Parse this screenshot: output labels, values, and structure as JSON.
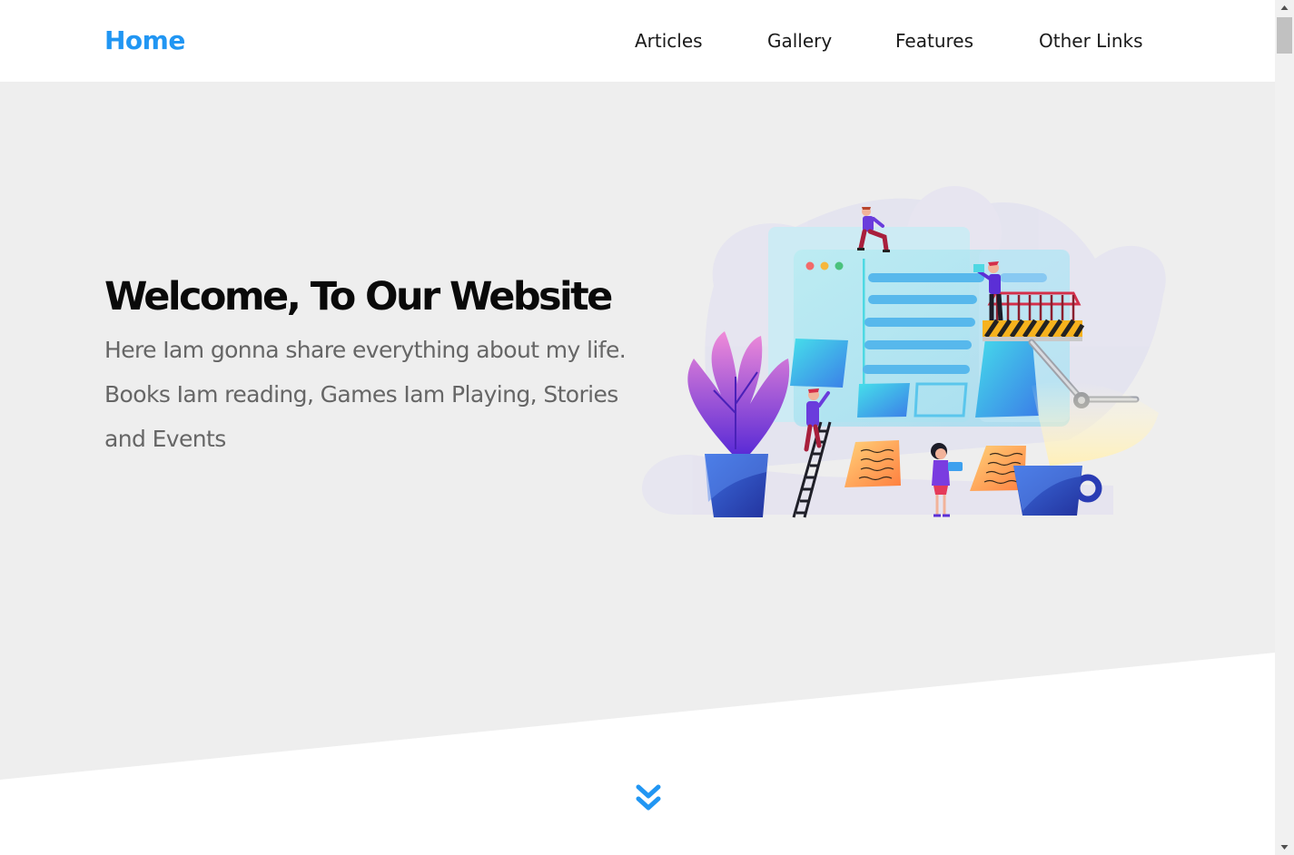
{
  "header": {
    "logo": "Home",
    "nav": [
      {
        "label": "Articles"
      },
      {
        "label": "Gallery"
      },
      {
        "label": "Features"
      },
      {
        "label": "Other Links"
      }
    ]
  },
  "hero": {
    "title": "Welcome, To Our Website",
    "text": "Here Iam gonna share everything about my life. Books Iam reading, Games Iam Playing, Stories and Events",
    "illustration": "website-building-illustration"
  },
  "icons": {
    "scroll_down": "double-chevron-down-icon",
    "scroll_up": "triangle-up-icon",
    "scroll_down_arrow": "triangle-down-icon"
  },
  "colors": {
    "accent": "#2196f3",
    "hero_background": "#eeeeee",
    "text_dark": "#0a0a0a",
    "text_muted": "#666666"
  }
}
